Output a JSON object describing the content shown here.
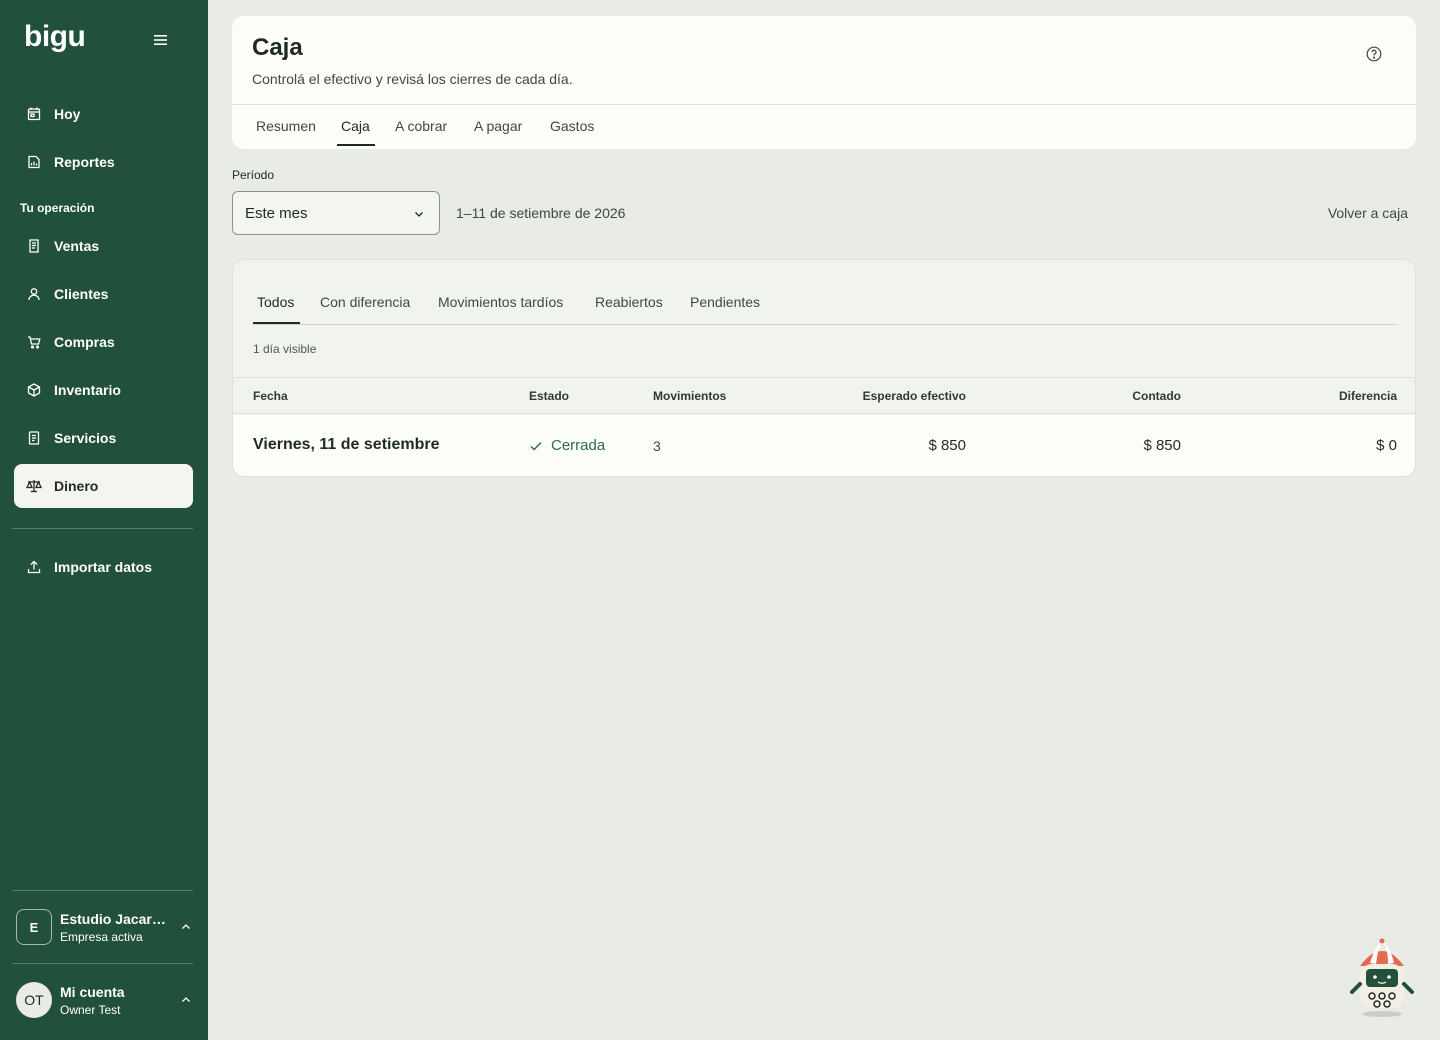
{
  "sidebar": {
    "logo": "bigu",
    "items_top": [
      {
        "label": "Hoy",
        "icon": "calendar-icon"
      },
      {
        "label": "Reportes",
        "icon": "report-icon"
      }
    ],
    "section_label": "Tu operación",
    "items_ops": [
      {
        "label": "Ventas",
        "icon": "receipt-icon"
      },
      {
        "label": "Clientes",
        "icon": "user-icon"
      },
      {
        "label": "Compras",
        "icon": "cart-icon"
      },
      {
        "label": "Inventario",
        "icon": "box-icon"
      },
      {
        "label": "Servicios",
        "icon": "document-icon"
      },
      {
        "label": "Dinero",
        "icon": "scale-icon",
        "active": true
      }
    ],
    "import_label": "Importar datos",
    "company": {
      "initial": "E",
      "name": "Estudio Jacarandá",
      "status": "Empresa activa"
    },
    "user": {
      "initials": "OT",
      "title": "Mi cuenta",
      "name": "Owner Test"
    }
  },
  "header": {
    "title": "Caja",
    "subtitle": "Controlá el efectivo y revisá los cierres de cada día.",
    "tabs": [
      "Resumen",
      "Caja",
      "A cobrar",
      "A pagar",
      "Gastos"
    ],
    "active_tab": "Caja"
  },
  "period": {
    "label": "Período",
    "selected": "Este mes",
    "range": "1–11 de setiembre de 2026",
    "back_link": "Volver a caja"
  },
  "table": {
    "filters": [
      "Todos",
      "Con diferencia",
      "Movimientos tardíos",
      "Reabiertos",
      "Pendientes"
    ],
    "active_filter": "Todos",
    "visible_count": "1 día visible",
    "columns": [
      "Fecha",
      "Estado",
      "Movimientos",
      "Esperado efectivo",
      "Contado",
      "Diferencia"
    ],
    "rows": [
      {
        "fecha": "Viernes, 11 de setiembre",
        "estado": "Cerrada",
        "movimientos": "3",
        "esperado": "$ 850",
        "contado": "$ 850",
        "diferencia": "$ 0"
      }
    ]
  },
  "colors": {
    "sidebar": "#21503c",
    "background": "#e8ebe6",
    "accent_status": "#2e6a4d"
  }
}
